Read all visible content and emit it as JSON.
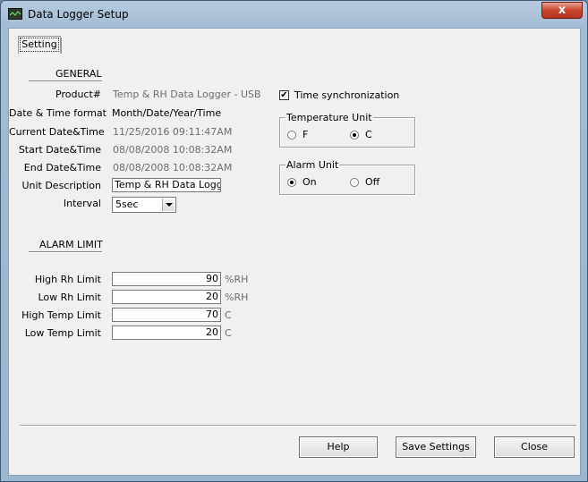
{
  "window": {
    "title": "Data Logger Setup",
    "close_glyph": "x"
  },
  "tabs": [
    {
      "label": "Setting"
    }
  ],
  "general": {
    "section_title": "GENERAL",
    "product_label": "Product#",
    "product_value": "Temp & RH Data Logger - USB",
    "datetime_format_label": "Date & Time format",
    "datetime_format_value": "Month/Date/Year/Time",
    "current_datetime_label": "Current Date&Time",
    "current_datetime_value": "11/25/2016 09:11:47AM",
    "start_datetime_label": "Start Date&Time",
    "start_datetime_value": "08/08/2008 10:08:32AM",
    "end_datetime_label": "End Date&Time",
    "end_datetime_value": "08/08/2008 10:08:32AM",
    "unit_description_label": "Unit Description",
    "unit_description_value": "Temp & RH Data Logger",
    "interval_label": "Interval",
    "interval_value": "5sec"
  },
  "time_sync": {
    "label": "Time synchronization",
    "checked": true,
    "check_glyph": "✔"
  },
  "temperature_unit": {
    "title": "Temperature Unit",
    "options": [
      {
        "label": "F",
        "selected": false
      },
      {
        "label": "C",
        "selected": true
      }
    ]
  },
  "alarm_unit": {
    "title": "Alarm Unit",
    "options": [
      {
        "label": "On",
        "selected": true
      },
      {
        "label": "Off",
        "selected": false
      }
    ]
  },
  "alarm_limit": {
    "section_title": "ALARM LIMIT",
    "rows": [
      {
        "label": "High Rh Limit",
        "value": "90",
        "unit": "%RH"
      },
      {
        "label": "Low Rh Limit",
        "value": "20",
        "unit": "%RH"
      },
      {
        "label": "High Temp Limit",
        "value": "70",
        "unit": "C"
      },
      {
        "label": "Low Temp Limit",
        "value": "20",
        "unit": "C"
      }
    ]
  },
  "buttons": {
    "help": "Help",
    "save": "Save Settings",
    "close": "Close"
  }
}
